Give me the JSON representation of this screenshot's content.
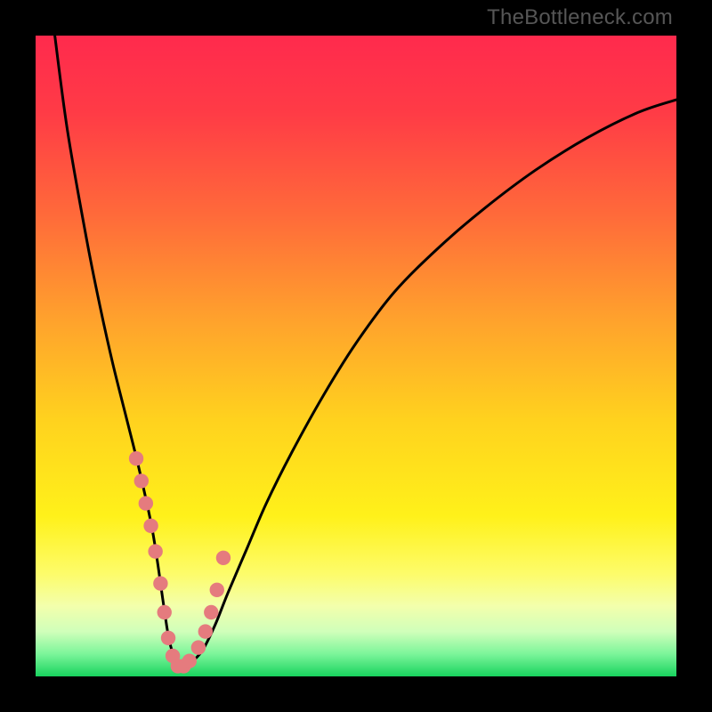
{
  "watermark": "TheBottleneck.com",
  "colors": {
    "frame": "#000000",
    "gradient_stops": [
      {
        "offset": 0.0,
        "color": "#ff2a4d"
      },
      {
        "offset": 0.12,
        "color": "#ff3b46"
      },
      {
        "offset": 0.28,
        "color": "#ff6a3a"
      },
      {
        "offset": 0.45,
        "color": "#ffa42c"
      },
      {
        "offset": 0.6,
        "color": "#ffd21e"
      },
      {
        "offset": 0.75,
        "color": "#fff11a"
      },
      {
        "offset": 0.84,
        "color": "#fdfc6a"
      },
      {
        "offset": 0.89,
        "color": "#f3ffac"
      },
      {
        "offset": 0.93,
        "color": "#d0ffba"
      },
      {
        "offset": 0.965,
        "color": "#7cf59a"
      },
      {
        "offset": 1.0,
        "color": "#18d35e"
      }
    ],
    "curve": "#000000",
    "marker_fill": "#e57b7e",
    "marker_stroke": "#c65e60"
  },
  "chart_data": {
    "type": "line",
    "title": "",
    "xlabel": "",
    "ylabel": "",
    "xlim": [
      0,
      100
    ],
    "ylim": [
      0,
      100
    ],
    "grid": false,
    "legend": false,
    "series": [
      {
        "name": "bottleneck-curve",
        "x": [
          3,
          5,
          8,
          10,
          12,
          14,
          16,
          18,
          19,
          20,
          21,
          22.5,
          24,
          26,
          28,
          30,
          33,
          36,
          40,
          45,
          50,
          56,
          63,
          70,
          78,
          86,
          94,
          100
        ],
        "y": [
          100,
          85,
          68,
          58,
          49,
          41,
          33,
          24,
          18,
          11,
          5,
          1.5,
          2,
          4,
          8,
          13,
          20,
          27,
          35,
          44,
          52,
          60,
          67,
          73,
          79,
          84,
          88,
          90
        ]
      }
    ],
    "markers": {
      "name": "highlight-points",
      "x": [
        15.7,
        16.5,
        17.2,
        18.0,
        18.7,
        19.5,
        20.1,
        20.7,
        21.4,
        22.2,
        23.1,
        24.0,
        25.4,
        26.5,
        27.4,
        28.3,
        29.3
      ],
      "y": [
        34,
        30.5,
        27,
        23.5,
        19.5,
        14.5,
        10,
        6,
        3.2,
        1.6,
        1.6,
        2.4,
        4.5,
        7.0,
        10.0,
        13.5,
        18.5
      ]
    }
  }
}
